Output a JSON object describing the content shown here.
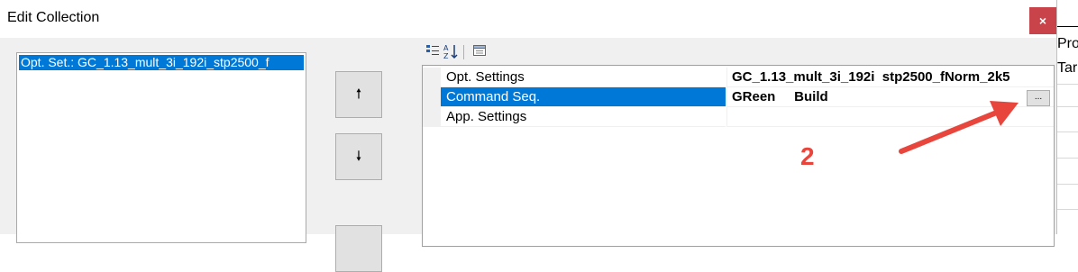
{
  "window": {
    "title": "Edit Collection",
    "close_glyph": "×"
  },
  "members_list": {
    "items": [
      "Opt. Set.: GC_1.13_mult_3i_192i_stp2500_f"
    ]
  },
  "move_buttons": {
    "up_glyph": "🠕",
    "down_glyph": "🠗"
  },
  "toolbar": {
    "categorized_icon": "categorized-icon",
    "alphabetical_icon": "alphabetical-icon",
    "property_pages_icon": "property-pages-icon"
  },
  "property_grid": {
    "rows": [
      {
        "name": "Opt. Settings",
        "value": "GC_1.13_mult_3i_192i  stp2500_fNorm_2k5",
        "selected": false
      },
      {
        "name": "Command Seq.",
        "value": "GReen     Build",
        "selected": true,
        "button": "..."
      },
      {
        "name": "App. Settings",
        "value": "",
        "selected": false
      }
    ]
  },
  "annotation": {
    "number": "2",
    "color": "#e8453c"
  },
  "right_panel": {
    "top_line": "___",
    "label_1": "Pro",
    "label_2": "Tar"
  },
  "colors": {
    "selection": "#0078d7",
    "close": "#c9444a"
  }
}
